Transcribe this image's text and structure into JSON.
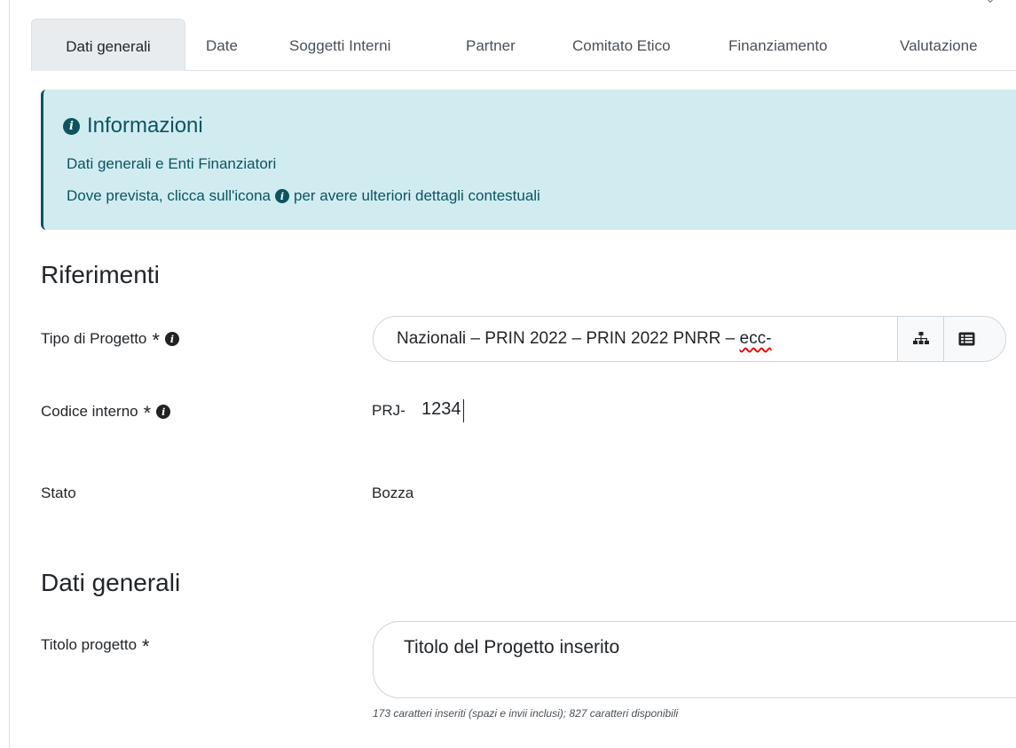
{
  "tabs": [
    {
      "label": "Dati generali",
      "active": true
    },
    {
      "label": "Date"
    },
    {
      "label": "Soggetti Interni"
    },
    {
      "label": "Partner"
    },
    {
      "label": "Comitato Etico"
    },
    {
      "label": "Finanziamento"
    },
    {
      "label": "Valutazione"
    }
  ],
  "alert": {
    "title": "Informazioni",
    "line1": "Dati generali e Enti Finanziatori",
    "line2_before": "Dove prevista, clicca sull'icona",
    "line2_after": "per avere ulteriori dettagli contestuali"
  },
  "sections": {
    "riferimenti": "Riferimenti",
    "dati_generali": "Dati generali"
  },
  "fields": {
    "tipo_progetto": {
      "label": "Tipo di Progetto",
      "required": "*",
      "value_main": "Nazionali – PRIN 2022 – PRIN 2022 PNRR – ",
      "value_tail": "ecc-"
    },
    "codice_interno": {
      "label": "Codice interno",
      "required": "*",
      "prefix": "PRJ-",
      "value": "1234"
    },
    "stato": {
      "label": "Stato",
      "value": "Bozza"
    },
    "titolo_progetto": {
      "label": "Titolo progetto",
      "required": "*",
      "value": "Titolo del Progetto inserito",
      "counter": "173 caratteri inseriti (spazi e invii inclusi); 827 caratteri disponibili"
    }
  },
  "icons": {
    "info": "info-circle-icon",
    "hierarchy": "sitemap-icon",
    "list": "list-alt-icon"
  },
  "colors": {
    "alert_bg": "#d1ecf1",
    "alert_text": "#0c5460",
    "tab_active_bg": "#e9ecef"
  }
}
